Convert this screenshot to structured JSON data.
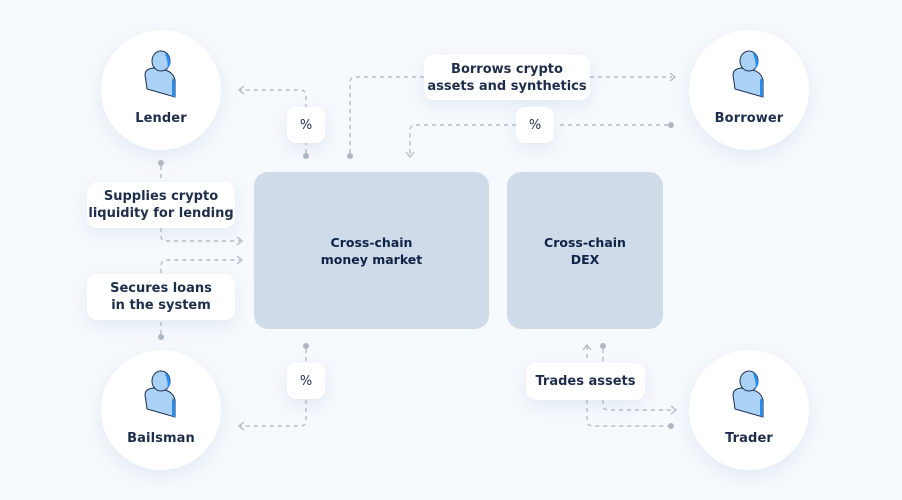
{
  "diagram": {
    "colors": {
      "background": "#f6f9fd",
      "node_fill": "#ffffff",
      "block_fill": "#cfdbe8",
      "text": "#1e2d4a",
      "connector": "#b6bcc6",
      "icon_fill": "#a9d2f6",
      "icon_accent": "#2b8cf0"
    },
    "actors": [
      {
        "id": "lender",
        "label": "Lender",
        "icon": "user-icon"
      },
      {
        "id": "borrower",
        "label": "Borrower",
        "icon": "user-icon"
      },
      {
        "id": "bailsman",
        "label": "Bailsman",
        "icon": "user-icon"
      },
      {
        "id": "trader",
        "label": "Trader",
        "icon": "user-icon"
      }
    ],
    "platforms": [
      {
        "id": "money-market",
        "label": "Cross-chain\nmoney market"
      },
      {
        "id": "dex",
        "label": "Cross-chain\nDEX"
      }
    ],
    "callouts": {
      "supplies": "Supplies crypto\nliquidity for lending",
      "secures": "Secures loans\nin the system",
      "borrows": "Borrows crypto\nassets and synthetics",
      "trades": "Trades assets"
    },
    "fees": {
      "lender_interest": "%",
      "borrower_interest": "%",
      "bailsman_interest": "%"
    }
  }
}
